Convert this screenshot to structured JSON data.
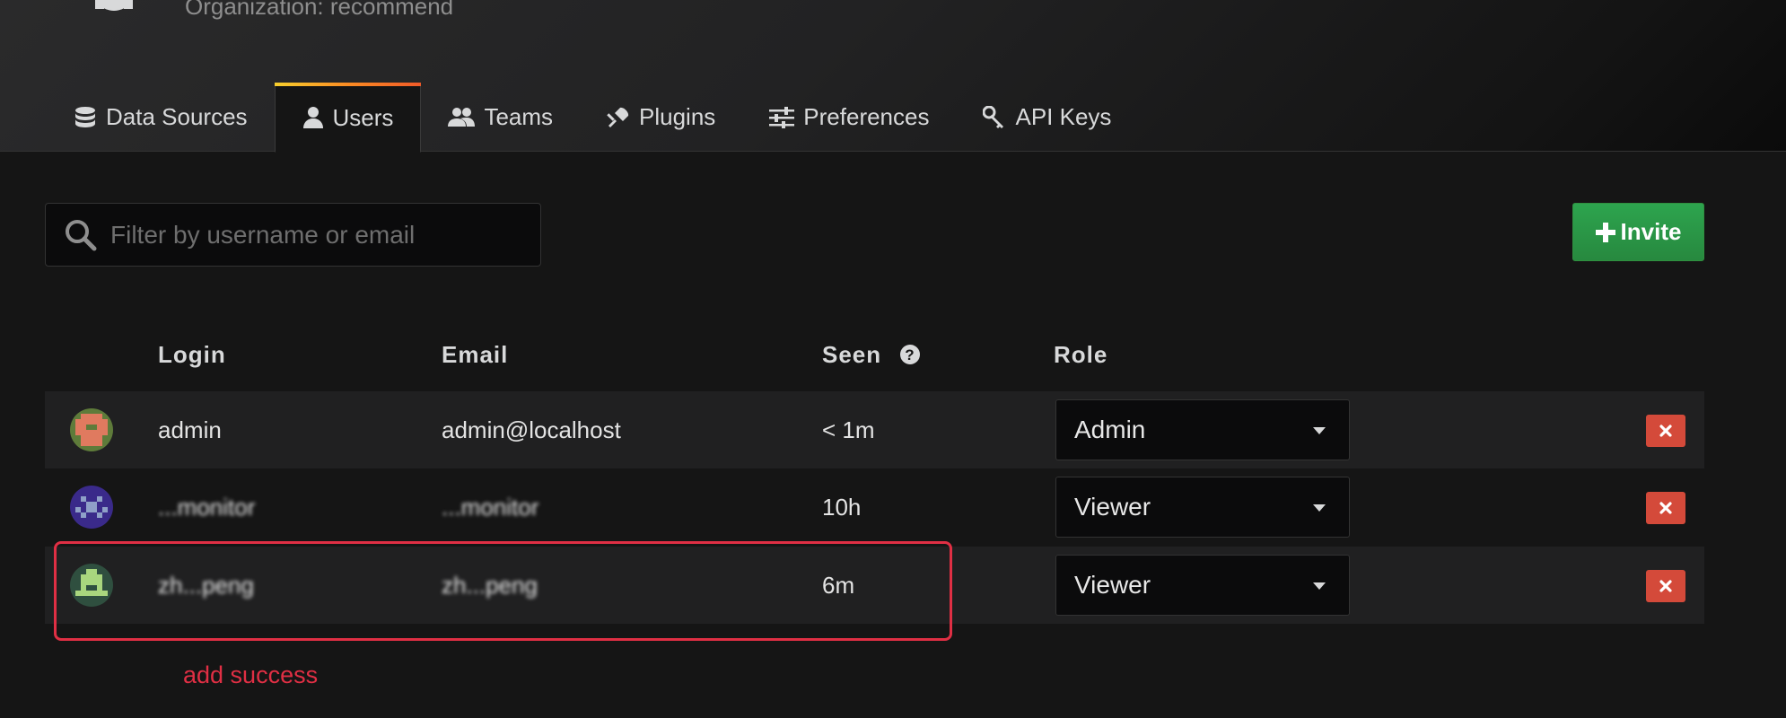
{
  "header": {
    "subtitle": "Organization: recommend"
  },
  "tabs": [
    {
      "label": "Data Sources",
      "icon": "database-icon",
      "active": false
    },
    {
      "label": "Users",
      "icon": "user-icon",
      "active": true
    },
    {
      "label": "Teams",
      "icon": "users-icon",
      "active": false
    },
    {
      "label": "Plugins",
      "icon": "plug-icon",
      "active": false
    },
    {
      "label": "Preferences",
      "icon": "sliders-icon",
      "active": false
    },
    {
      "label": "API Keys",
      "icon": "key-icon",
      "active": false
    }
  ],
  "search": {
    "placeholder": "Filter by username or email"
  },
  "invite_button": {
    "label": "Invite",
    "color": "#299c46"
  },
  "table": {
    "columns": [
      "Login",
      "Email",
      "Seen",
      "Role"
    ],
    "rows": [
      {
        "login": "admin",
        "email": "admin@localhost",
        "seen": "< 1m",
        "role": "Admin"
      },
      {
        "login": "...monitor",
        "email": "...monitor",
        "seen": "10h",
        "role": "Viewer"
      },
      {
        "login": "zh...peng",
        "email": "zh...peng",
        "seen": "6m",
        "role": "Viewer"
      }
    ]
  },
  "annotation": {
    "text": "add success",
    "color": "#e02f44"
  }
}
